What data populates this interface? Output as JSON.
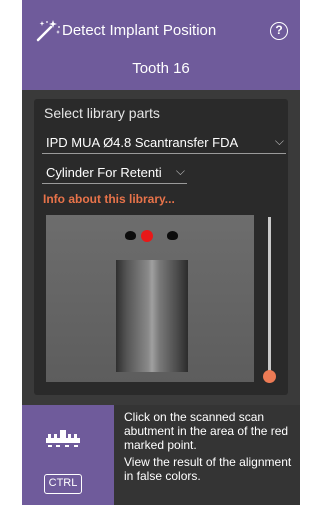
{
  "header": {
    "title": "Detect Implant Position",
    "subtitle": "Tooth 16",
    "wand_icon": "magic-wand-icon",
    "help_icon": "help-circle-icon",
    "help_glyph": "?",
    "bg_color": "#6f5b9b"
  },
  "library": {
    "section_label": "Select library parts",
    "part_select": {
      "value": "IPD MUA Ø4.8 Scantransfer FDA"
    },
    "variant_select": {
      "value": "Cylinder For Retenti"
    },
    "info_link": "Info about this library...",
    "info_link_color": "#e8734a",
    "chevron_glyph": "⌵"
  },
  "preview": {
    "marker_color": "#e81818",
    "slider_value": 0.0,
    "slider_color": "#ed7b55"
  },
  "instructions": {
    "icon": "click-scan-icon",
    "ctrl_label": "CTRL",
    "text1": "Click on the scanned scan abutment in the area of the red marked point.",
    "text2": "View the result of the alignment in false colors."
  }
}
